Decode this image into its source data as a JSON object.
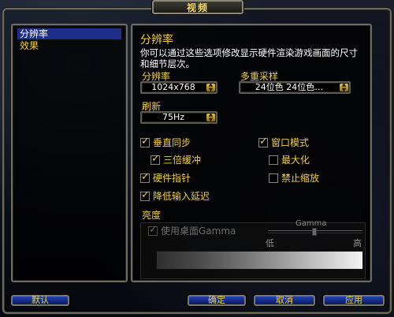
{
  "window": {
    "title": "视频"
  },
  "nav": {
    "items": [
      {
        "label": "分辨率",
        "active": true
      },
      {
        "label": "效果",
        "active": false
      }
    ]
  },
  "main": {
    "heading": "分辨率",
    "description": "你可以通过这些选项修改显示硬件渲染游戏画面的尺寸和细节层次。",
    "resolution": {
      "label": "分辨率",
      "value": "1024x768"
    },
    "multisample": {
      "label": "多重采样",
      "value": "24位色 24位色…"
    },
    "refresh": {
      "label": "刷新",
      "value": "75Hz"
    },
    "checks": {
      "vsync": {
        "label": "垂直同步",
        "checked": true
      },
      "window_mode": {
        "label": "窗口模式",
        "checked": true
      },
      "triple_buffer": {
        "label": "三倍缓冲",
        "checked": true
      },
      "maximize": {
        "label": "最大化",
        "checked": false
      },
      "hw_cursor": {
        "label": "硬件指针",
        "checked": true
      },
      "disable_scale": {
        "label": "禁止缩放",
        "checked": false
      },
      "low_latency": {
        "label": "降低输入延迟",
        "checked": true
      }
    },
    "brightness": {
      "label": "亮度",
      "use_desktop_gamma": {
        "label": "使用桌面Gamma",
        "checked": true
      },
      "gamma_label": "Gamma",
      "low": "低",
      "high": "高",
      "gamma_level": 0.5
    }
  },
  "footer": {
    "default_label": "默认",
    "ok_label": "确定",
    "cancel_label": "取消",
    "apply_label": "应用"
  },
  "colors": {
    "accent_yellow": "#f1cf3b",
    "nav_highlight": "#1d2f8a",
    "button_blue": "#142a85"
  }
}
